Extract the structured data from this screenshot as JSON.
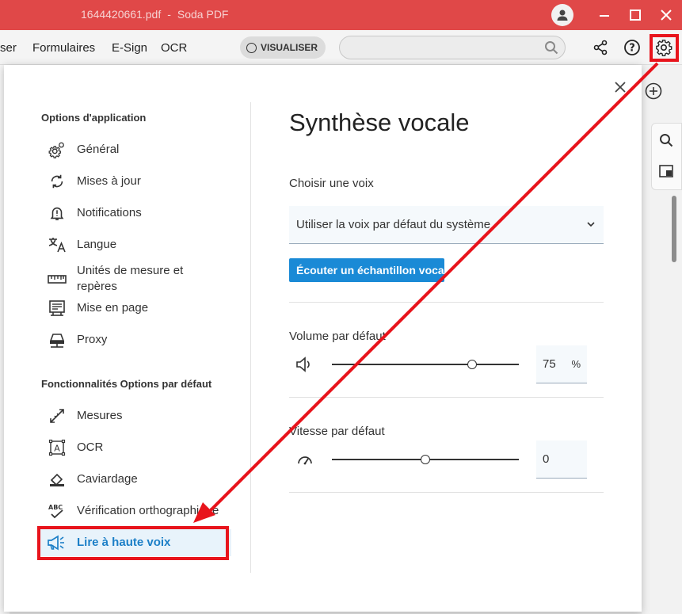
{
  "window": {
    "filename": "1644420661.pdf",
    "separator": "-",
    "app_name": "Soda PDF"
  },
  "menubar": {
    "items": [
      "ser",
      "Formulaires",
      "E-Sign",
      "OCR"
    ],
    "view_button": "VISUALISER",
    "search_placeholder": ""
  },
  "settings": {
    "section_app": "Options d'application",
    "app_items": [
      {
        "label": "Général",
        "icon": "gear-icon"
      },
      {
        "label": "Mises à jour",
        "icon": "refresh-icon"
      },
      {
        "label": "Notifications",
        "icon": "bell-icon"
      },
      {
        "label": "Langue",
        "icon": "translate-icon"
      },
      {
        "label": "Unités de mesure et repères",
        "icon": "ruler-icon"
      },
      {
        "label": "Mise en page",
        "icon": "layout-icon"
      },
      {
        "label": "Proxy",
        "icon": "proxy-icon"
      }
    ],
    "section_features": "Fonctionnalités Options par défaut",
    "feature_items": [
      {
        "label": "Mesures",
        "icon": "measure-icon"
      },
      {
        "label": "OCR",
        "icon": "ocr-icon"
      },
      {
        "label": "Caviardage",
        "icon": "eraser-icon"
      },
      {
        "label": "Vérification orthographique",
        "icon": "spellcheck-icon"
      },
      {
        "label": "Lire à haute voix",
        "icon": "megaphone-icon",
        "active": true
      }
    ]
  },
  "panel": {
    "title": "Synthèse vocale",
    "voice_label": "Choisir une voix",
    "voice_value": "Utiliser la voix par défaut du système",
    "sample_button": "Écouter un échantillon vocal",
    "volume_label": "Volume par défaut",
    "volume_value": "75",
    "volume_unit": "%",
    "volume_fraction": 0.75,
    "speed_label": "Vitesse par défaut",
    "speed_value": "0",
    "speed_fraction": 0.5
  },
  "colors": {
    "titlebar": "#e04848",
    "accent": "#1a8ad6",
    "annotation": "#e8141c"
  }
}
